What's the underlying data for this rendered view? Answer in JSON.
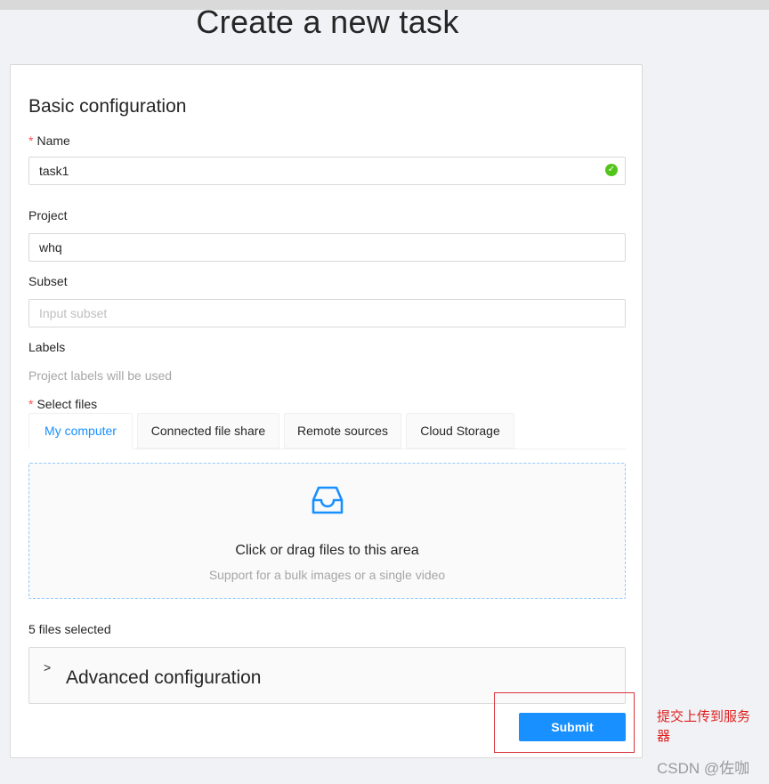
{
  "page": {
    "title": "Create a new task"
  },
  "basic": {
    "title": "Basic configuration",
    "name": {
      "label": "Name",
      "required_mark": "*",
      "value": "task1"
    },
    "project": {
      "label": "Project",
      "value": "whq"
    },
    "subset": {
      "label": "Subset",
      "value": "",
      "placeholder": "Input subset"
    },
    "labels": {
      "label": "Labels",
      "hint": "Project labels will be used"
    }
  },
  "files": {
    "label": "Select files",
    "required_mark": "*",
    "tabs": [
      "My computer",
      "Connected file share",
      "Remote sources",
      "Cloud Storage"
    ],
    "active_tab": "My computer",
    "dropzone": {
      "icon": "inbox-icon",
      "text": "Click or drag files to this area",
      "hint": "Support for a bulk images or a single video"
    },
    "selected_count": "5 files selected"
  },
  "advanced": {
    "title": "Advanced configuration",
    "expand_icon": "chevron-right-icon"
  },
  "actions": {
    "submit_label": "Submit"
  },
  "annotation": {
    "text": "提交上传到服务器"
  },
  "watermark": {
    "text": "CSDN @佐咖"
  },
  "colors": {
    "accent": "#1890ff",
    "success": "#52c41a",
    "required": "#ff4d4f",
    "annotation": "#e02020"
  }
}
